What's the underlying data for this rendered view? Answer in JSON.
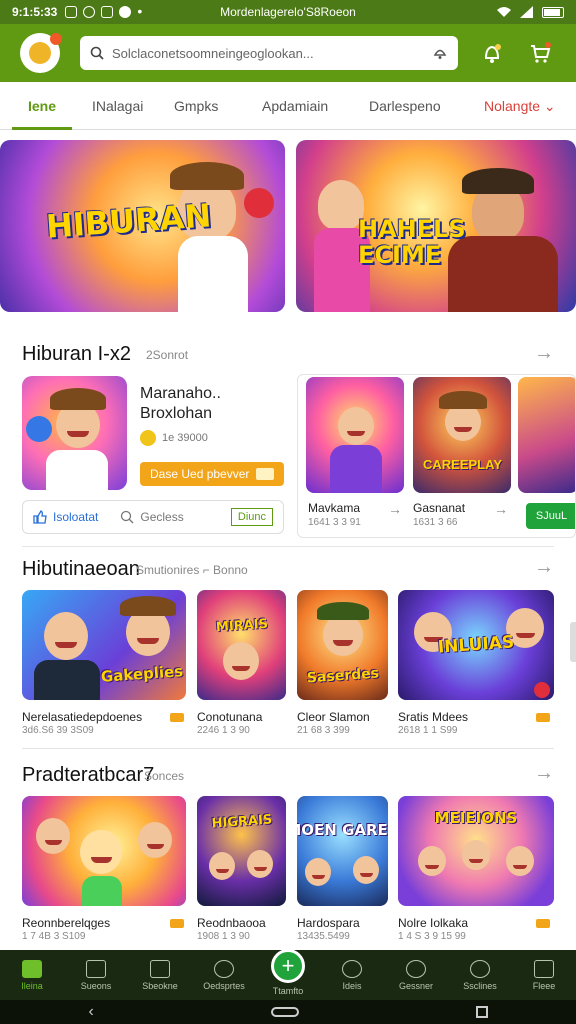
{
  "status_bar": {
    "time": "9:1:5:33",
    "carrier": "Mordenlagerelo'S8Roeon",
    "battery_level": 0.8
  },
  "header": {
    "search_placeholder": "Solclaconetsoomneingeoglookan..."
  },
  "tabs": [
    {
      "label": "Iene",
      "active": true
    },
    {
      "label": "INalagai"
    },
    {
      "label": "Gmpks"
    },
    {
      "label": "Apdamiain"
    },
    {
      "label": "Darlespeno"
    },
    {
      "label": "Nolangte ⌄"
    }
  ],
  "banners": [
    {
      "title": "HIBURAN"
    },
    {
      "title": "HAHELS ECIME"
    }
  ],
  "section1": {
    "title": "Hiburan I-x2",
    "subtitle": "2Sonrot",
    "featured": {
      "name": "Maranaho.. Broxlohan",
      "rating": "1e 39000",
      "button": "Dase Ued pbevver",
      "action_like": "Isoloatat",
      "action_comment": "Gecless",
      "action_more": "Diunc"
    },
    "minis": [
      {
        "name": "Mavkama",
        "meta": "1641 3 3 91"
      },
      {
        "name": "Gasnanat",
        "meta": "1631 3 66"
      }
    ],
    "green_button": "SJuuL"
  },
  "section2": {
    "title": "Hibutinaeoan",
    "subtitle": "Smutionires ⌐ Bonno",
    "tiles": [
      {
        "label": "Gakeplies",
        "name": "Nerelasatiedepdoenes",
        "meta": "3d6.S6 39 3S09"
      },
      {
        "label": "MIRAIS",
        "name": "Conotunana",
        "meta": "2246 1 3 90"
      },
      {
        "label": "Saserdes",
        "name": "Cleor Slamon",
        "meta": "21 68 3 399"
      },
      {
        "label": "INLUIAS",
        "name": "Sratis Mdees",
        "meta": "2618 1 1 S99"
      }
    ]
  },
  "section3": {
    "title": "Pradteratbcar7",
    "subtitle": "Sonces",
    "tiles": [
      {
        "label": "",
        "name": "Reonnberelqges",
        "meta": "1 7 4B 3 S109"
      },
      {
        "label": "HIGRAIS",
        "name": "Reodnbaooa",
        "meta": "1908 1 3 90"
      },
      {
        "label": "MOEN GARES",
        "name": "Hardospara",
        "meta": "13435.5499"
      },
      {
        "label": "MEIEIONS",
        "name": "Nolre Iolkaka",
        "meta": "1 4 S 3 9 15 99"
      }
    ]
  },
  "bottom_nav": [
    {
      "label": "Ileina",
      "active": true
    },
    {
      "label": "Sueons"
    },
    {
      "label": "Sbeokne"
    },
    {
      "label": "Oedsprtes"
    },
    {
      "label": "Ttamfto",
      "plus": true
    },
    {
      "label": "Ideis"
    },
    {
      "label": "Gessner"
    },
    {
      "label": "Ssclines"
    },
    {
      "label": "Fleee"
    }
  ],
  "colors": {
    "brand_green": "#5f9a12",
    "accent_orange": "#f3a51a",
    "nav_bg": "#1a2a12"
  }
}
